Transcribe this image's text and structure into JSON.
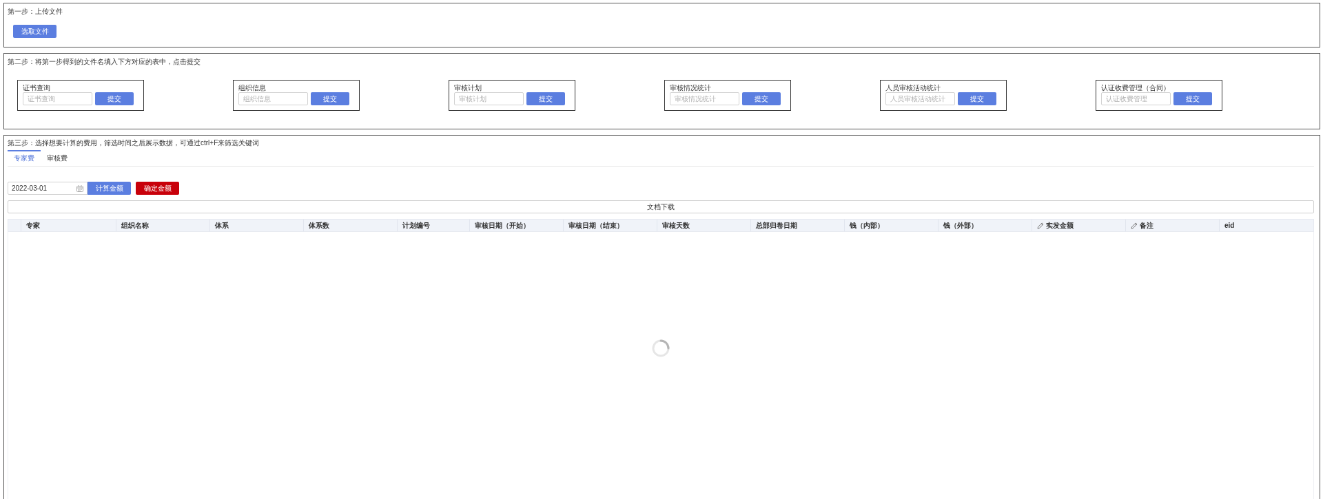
{
  "step_1": {
    "title": "第一步：上传文件",
    "button": "选取文件"
  },
  "step_2": {
    "title": "第二步：将第一步得到的文件名填入下方对应的表中，点击提交",
    "forms": [
      {
        "label": "证书查询",
        "placeholder": "证书查询",
        "button": "提交"
      },
      {
        "label": "组织信息",
        "placeholder": "组织信息",
        "button": "提交"
      },
      {
        "label": "审核计划",
        "placeholder": "审核计划",
        "button": "提交"
      },
      {
        "label": "审核情况统计",
        "placeholder": "审核情况统计",
        "button": "提交"
      },
      {
        "label": "人员审核活动统计",
        "placeholder": "人员审核活动统计",
        "button": "提交"
      },
      {
        "label": "认证收费管理（合同）",
        "placeholder": "认证收费管理",
        "button": "提交"
      }
    ]
  },
  "step_3": {
    "title": "第三步：选择想要计算的费用，筛选时间之后展示数据，可通过ctrl+F来筛选关键词",
    "tabs": [
      {
        "label": "专家费",
        "selected": true
      },
      {
        "label": "审核费",
        "selected": false
      }
    ],
    "date_field": {
      "value": "2022-03-01"
    },
    "buttons": [
      {
        "label": "计算金额",
        "kind": "primary"
      },
      {
        "label": "确定金额",
        "kind": "danger"
      }
    ],
    "download_button": "文档下载",
    "table": {
      "loading": true,
      "columns": [
        {
          "label": "专家",
          "editable": false
        },
        {
          "label": "组织名称",
          "editable": false
        },
        {
          "label": "体系",
          "editable": false
        },
        {
          "label": "体系数",
          "editable": false
        },
        {
          "label": "计划编号",
          "editable": false
        },
        {
          "label": "审核日期（开始）",
          "editable": false
        },
        {
          "label": "审核日期（结束）",
          "editable": false
        },
        {
          "label": "审核天数",
          "editable": false
        },
        {
          "label": "总部归卷日期",
          "editable": false
        },
        {
          "label": "钱（内部）",
          "editable": false
        },
        {
          "label": "钱（外部）",
          "editable": false
        },
        {
          "label": "实发金额",
          "editable": true
        },
        {
          "label": "备注",
          "editable": true
        },
        {
          "label": "eid",
          "editable": false
        }
      ]
    }
  }
}
